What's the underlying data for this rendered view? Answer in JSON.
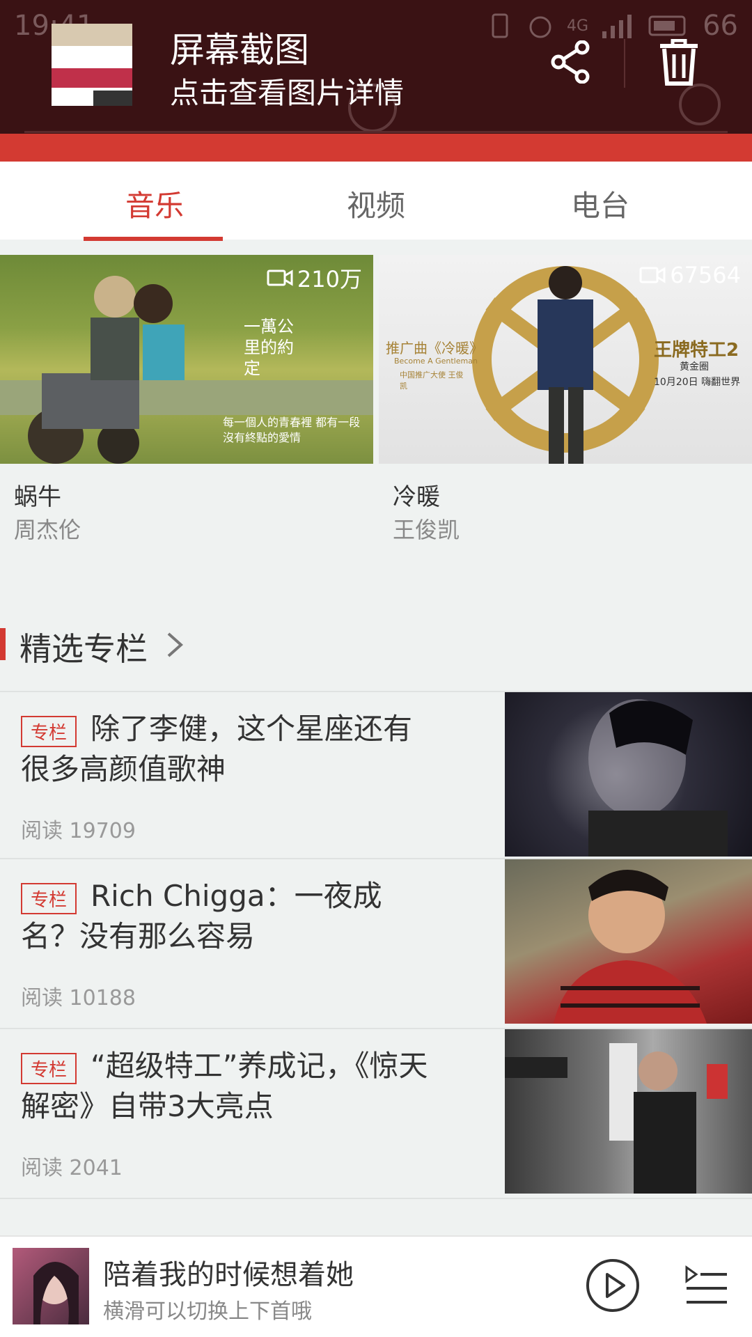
{
  "status": {
    "time": "19:41",
    "battery": "66",
    "network": "4G"
  },
  "notification": {
    "title": "屏幕截图",
    "subtitle": "点击查看图片详情"
  },
  "tabs": [
    {
      "label": "音乐"
    },
    {
      "label": "视频"
    },
    {
      "label": "电台"
    }
  ],
  "videos": [
    {
      "count": "210万",
      "title": "蜗牛",
      "artist": "周杰伦",
      "poster_text1": "一萬公里的約定",
      "poster_text2": "每一個人的青春裡 都有一段沒有終點的愛情"
    },
    {
      "count": "67564",
      "title": "冷暖",
      "artist": "王俊凯",
      "poster_left": "推广曲《冷暖》",
      "poster_left2": "Become A Gentleman",
      "poster_left3": "中国推广大使 王俊凯",
      "poster_right": "王牌特工2",
      "poster_right2": "黄金圈",
      "poster_right3": "10月20日 嗨翻世界"
    }
  ],
  "section": {
    "title": "精选专栏"
  },
  "articles": [
    {
      "tag": "专栏",
      "title": "除了李健，这个星座还有很多高颜值歌神",
      "reads": "阅读 19709"
    },
    {
      "tag": "专栏",
      "title": "Rich Chigga：一夜成名？没有那么容易",
      "reads": "阅读 10188"
    },
    {
      "tag": "专栏",
      "title": "“超级特工”养成记，《惊天解密》自带3大亮点",
      "reads": "阅读 2041"
    }
  ],
  "player": {
    "song": "陪着我的时候想着她",
    "hint": "横滑可以切换上下首哦"
  },
  "colors": {
    "accent": "#d33a32",
    "header": "#3a1214"
  }
}
